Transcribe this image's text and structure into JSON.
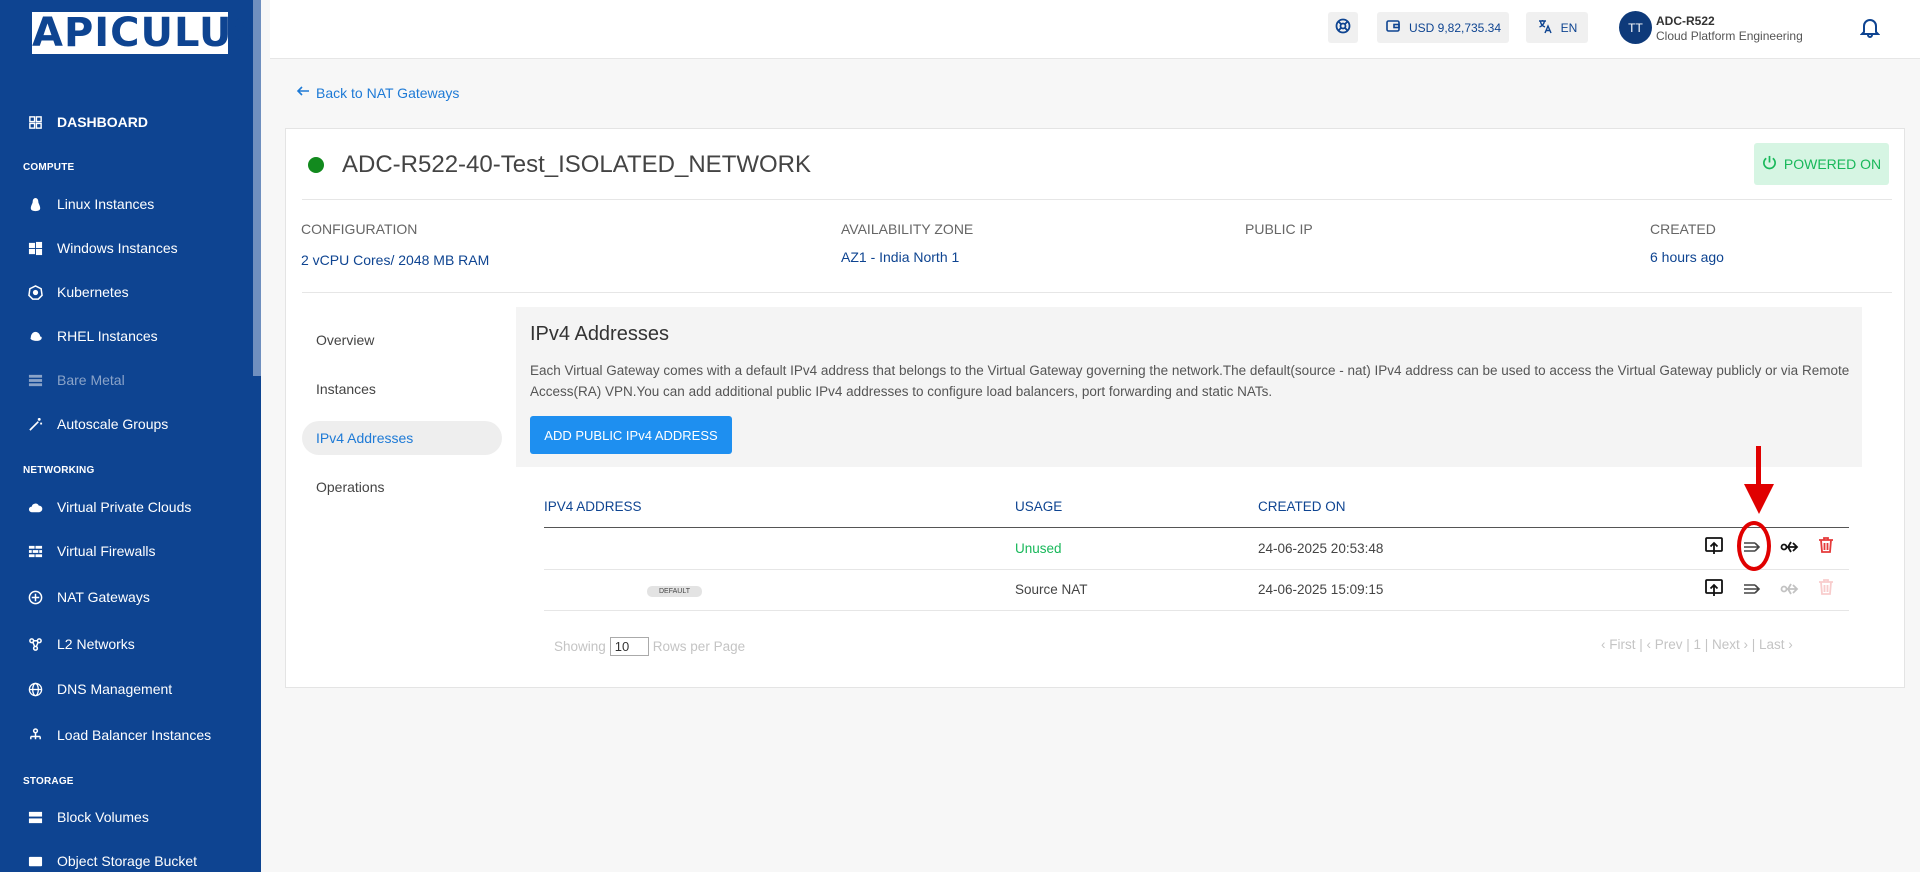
{
  "sidebar": {
    "logo": "APICULUS",
    "dashboard": "DASHBOARD",
    "sections": {
      "compute": "COMPUTE",
      "networking": "NETWORKING",
      "storage": "STORAGE"
    },
    "items": [
      {
        "label": "Linux Instances",
        "icon": "linux-icon"
      },
      {
        "label": "Windows Instances",
        "icon": "windows-icon"
      },
      {
        "label": "Kubernetes",
        "icon": "kubernetes-icon"
      },
      {
        "label": "RHEL Instances",
        "icon": "rhel-icon"
      },
      {
        "label": "Bare Metal",
        "icon": "server-icon"
      },
      {
        "label": "Autoscale Groups",
        "icon": "wand-icon"
      },
      {
        "label": "Virtual Private Clouds",
        "icon": "cloud-icon"
      },
      {
        "label": "Virtual Firewalls",
        "icon": "firewall-icon"
      },
      {
        "label": "NAT Gateways",
        "icon": "nat-icon"
      },
      {
        "label": "L2 Networks",
        "icon": "l2-icon"
      },
      {
        "label": "DNS Management",
        "icon": "globe-icon"
      },
      {
        "label": "Load Balancer Instances",
        "icon": "load-balancer-icon"
      },
      {
        "label": "Block Volumes",
        "icon": "volume-icon"
      },
      {
        "label": "Object Storage Bucket",
        "icon": "bucket-icon"
      }
    ]
  },
  "header": {
    "balance": "USD 9,82,735.34",
    "language": "EN",
    "user_initials": "TT",
    "user_name": "ADC-R522",
    "user_org": "Cloud Platform Engineering"
  },
  "page": {
    "back_link": "Back to NAT Gateways",
    "title": "ADC-R522-40-Test_ISOLATED_NETWORK",
    "status": "POWERED ON",
    "status_color": "#18b85a",
    "info": {
      "configuration_label": "CONFIGURATION",
      "configuration_value": "2 vCPU Cores/ 2048 MB RAM",
      "zone_label": "AVAILABILITY ZONE",
      "zone_value": "AZ1 - India North 1",
      "public_ip_label": "PUBLIC IP",
      "created_label": "CREATED",
      "created_value": "6 hours ago"
    },
    "tabs": [
      "Overview",
      "Instances",
      "IPv4 Addresses",
      "Operations"
    ],
    "active_tab": "IPv4 Addresses"
  },
  "ipv4": {
    "title": "IPv4 Addresses",
    "description": "Each Virtual Gateway comes with a default IPv4 address that belongs to the Virtual Gateway governing the network.The default(source - nat) IPv4 address can be used to access the Virtual Gateway publicly or via Remote Access(RA) VPN.You can add additional public IPv4 addresses to configure load balancers, port forwarding and static NATs.",
    "add_button": "ADD PUBLIC IPv4 ADDRESS",
    "columns": [
      "IPV4 ADDRESS",
      "USAGE",
      "CREATED ON"
    ],
    "rows": [
      {
        "address": "",
        "usage": "Unused",
        "created_on": "24-06-2025 20:53:48"
      },
      {
        "address": "",
        "badge": "DEFAULT",
        "usage": "Source NAT",
        "created_on": "24-06-2025 15:09:15"
      }
    ],
    "pagination": {
      "showing": "Showing",
      "rows_value": "10",
      "rows_label": "Rows per Page",
      "nav": "‹ First  |  ‹ Prev  |  1 |  Next ›  |  Last ›"
    }
  }
}
